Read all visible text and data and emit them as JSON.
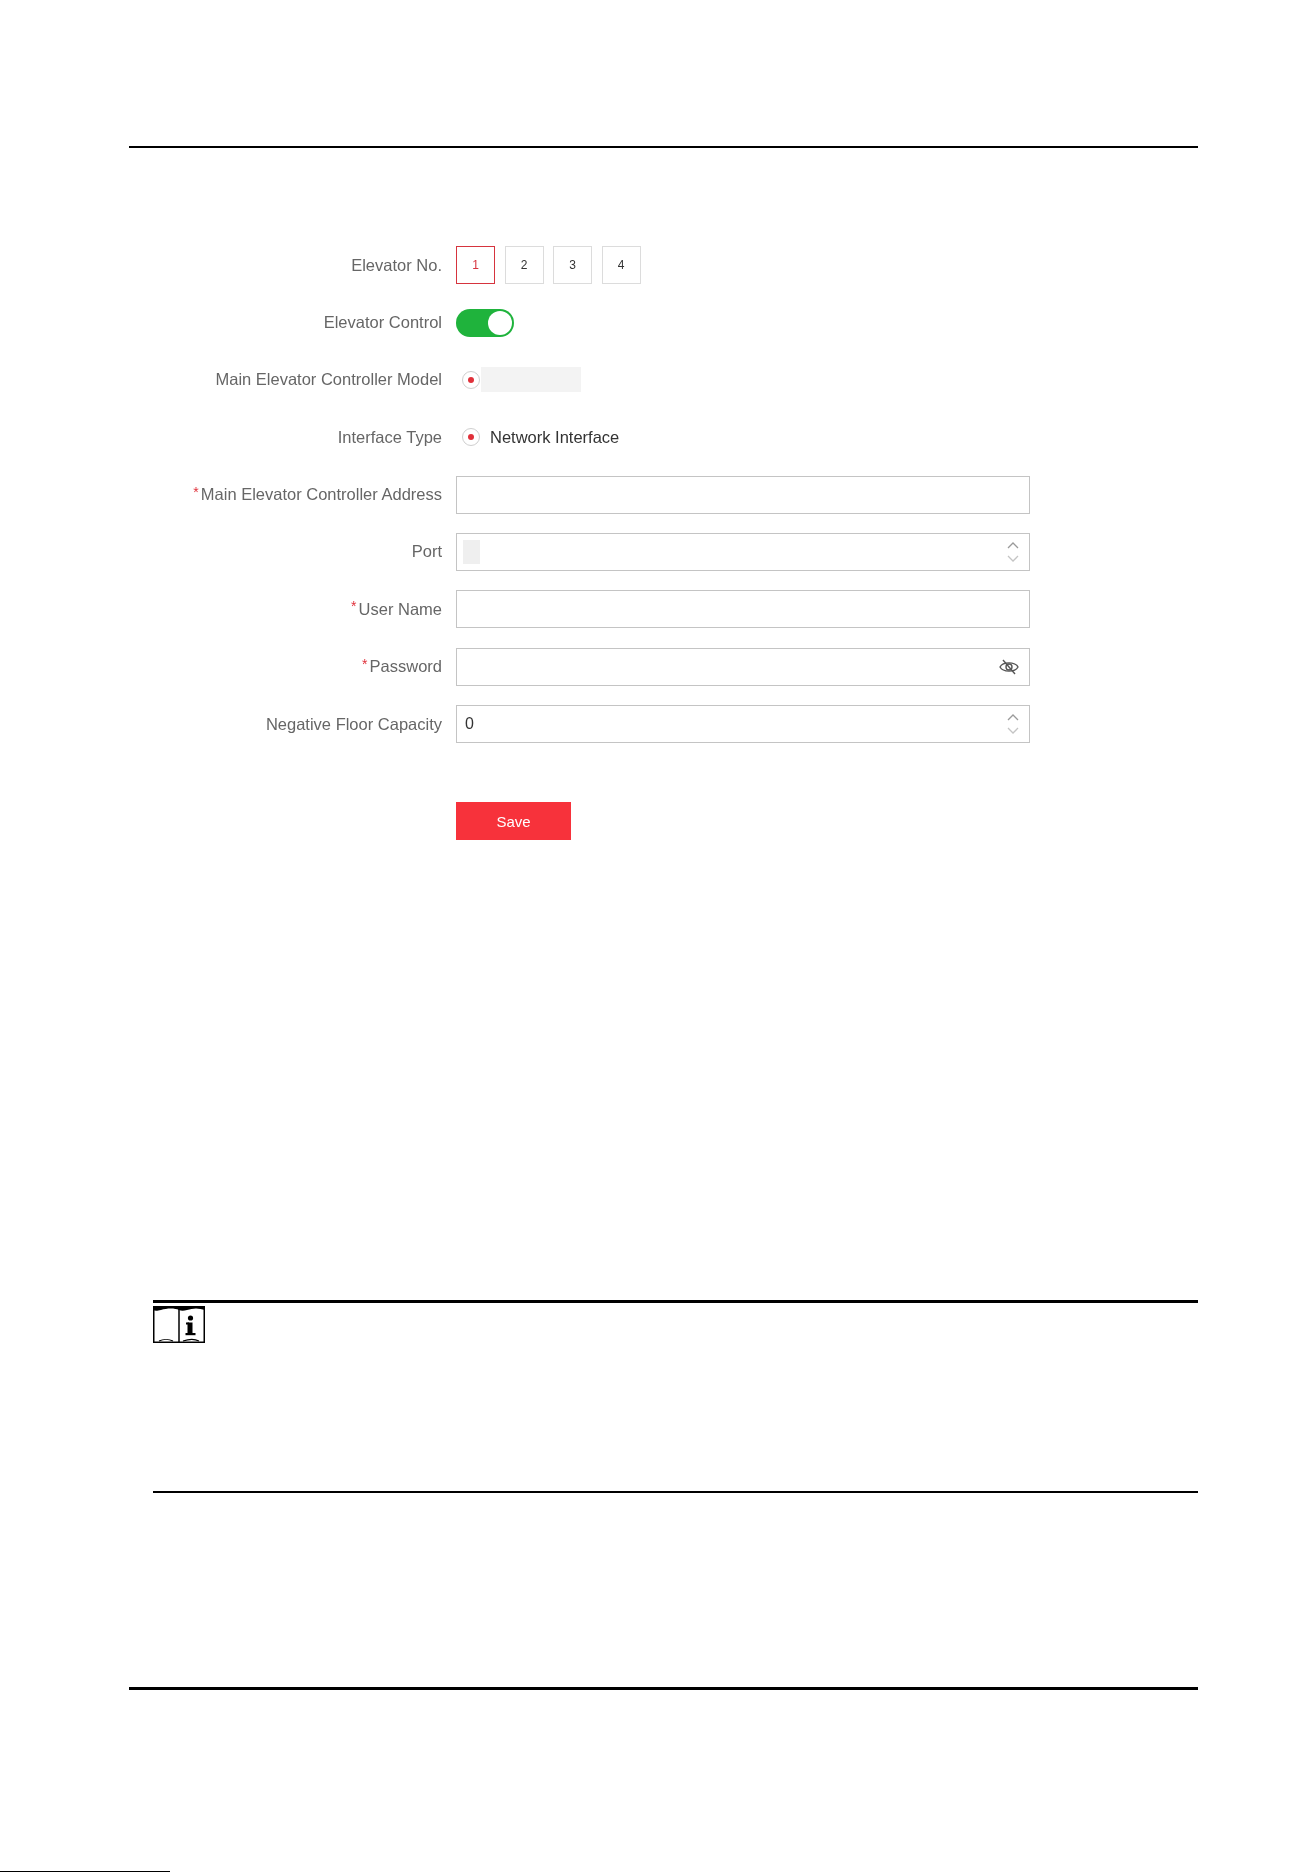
{
  "form": {
    "elevator_no": {
      "label": "Elevator No.",
      "options": [
        {
          "label": "1",
          "selected": true
        },
        {
          "label": "2",
          "selected": false
        },
        {
          "label": "3",
          "selected": false
        },
        {
          "label": "4",
          "selected": false
        }
      ]
    },
    "elevator_control": {
      "label": "Elevator Control",
      "on": true
    },
    "controller_model": {
      "label": "Main Elevator Controller Model",
      "options": [
        {
          "selected": true
        }
      ]
    },
    "interface_type": {
      "label": "Interface Type",
      "options": [
        {
          "label": "Network Interface",
          "selected": true
        }
      ]
    },
    "fields": [
      {
        "kind": "text",
        "label": "Main Elevator Controller Address",
        "required_mark": "*"
      },
      {
        "kind": "number_masked",
        "label": "Port"
      },
      {
        "kind": "text",
        "label": "User Name",
        "required_mark": "*"
      },
      {
        "kind": "password",
        "label": "Password",
        "required_mark": "*"
      },
      {
        "kind": "number",
        "label": "Negative Floor Capacity",
        "value": "0"
      }
    ],
    "save_button": {
      "label": "Save"
    }
  }
}
